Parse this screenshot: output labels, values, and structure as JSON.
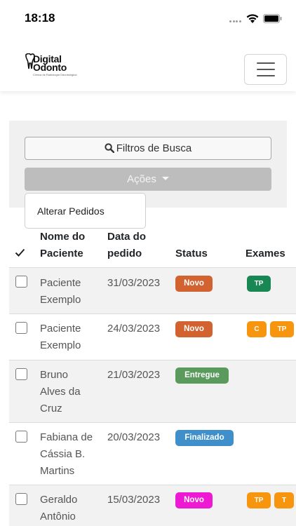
{
  "status_bar": {
    "time": "18:18"
  },
  "logo": {
    "line1": "Digital",
    "line2": "Odonto",
    "tagline": "Clínica de Radiologia Odontológica"
  },
  "filters": {
    "label": "Filtros de Busca"
  },
  "actions": {
    "label": "Ações",
    "menu_items": [
      "Alterar Pedidos"
    ]
  },
  "table": {
    "headers": {
      "patient_line1": "Nome do",
      "patient_line2": "Paciente",
      "date_line1": "Data do",
      "date_line2": "pedido",
      "status": "Status",
      "exams": "Exames"
    },
    "rows": [
      {
        "name_lines": [
          "Paciente",
          "Exemplo"
        ],
        "date": "31/03/2023",
        "status": "Novo",
        "exams": [
          "TP"
        ]
      },
      {
        "name_lines": [
          "Paciente",
          "Exemplo"
        ],
        "date": "24/03/2023",
        "status": "Novo",
        "exams": [
          "C",
          "TP"
        ]
      },
      {
        "name_lines": [
          "Bruno",
          "Alves da",
          "Cruz"
        ],
        "date": "21/03/2023",
        "status": "Entregue",
        "exams": []
      },
      {
        "name_lines": [
          "Fabiana de",
          "Cássia B.",
          "Martins"
        ],
        "date": "20/03/2023",
        "status": "Finalizado",
        "exams": []
      },
      {
        "name_lines": [
          "Geraldo",
          "Antônio"
        ],
        "date": "15/03/2023",
        "status": "Novo",
        "exams": [
          "TP",
          "T"
        ]
      }
    ]
  },
  "colors": {
    "novo": "#d2622f",
    "novo_magenta": "#ee1ad3",
    "entregue": "#5a9b5d",
    "finalizado": "#3f8fcb",
    "exam_green": "#198754",
    "exam_orange": "#f7950f"
  }
}
